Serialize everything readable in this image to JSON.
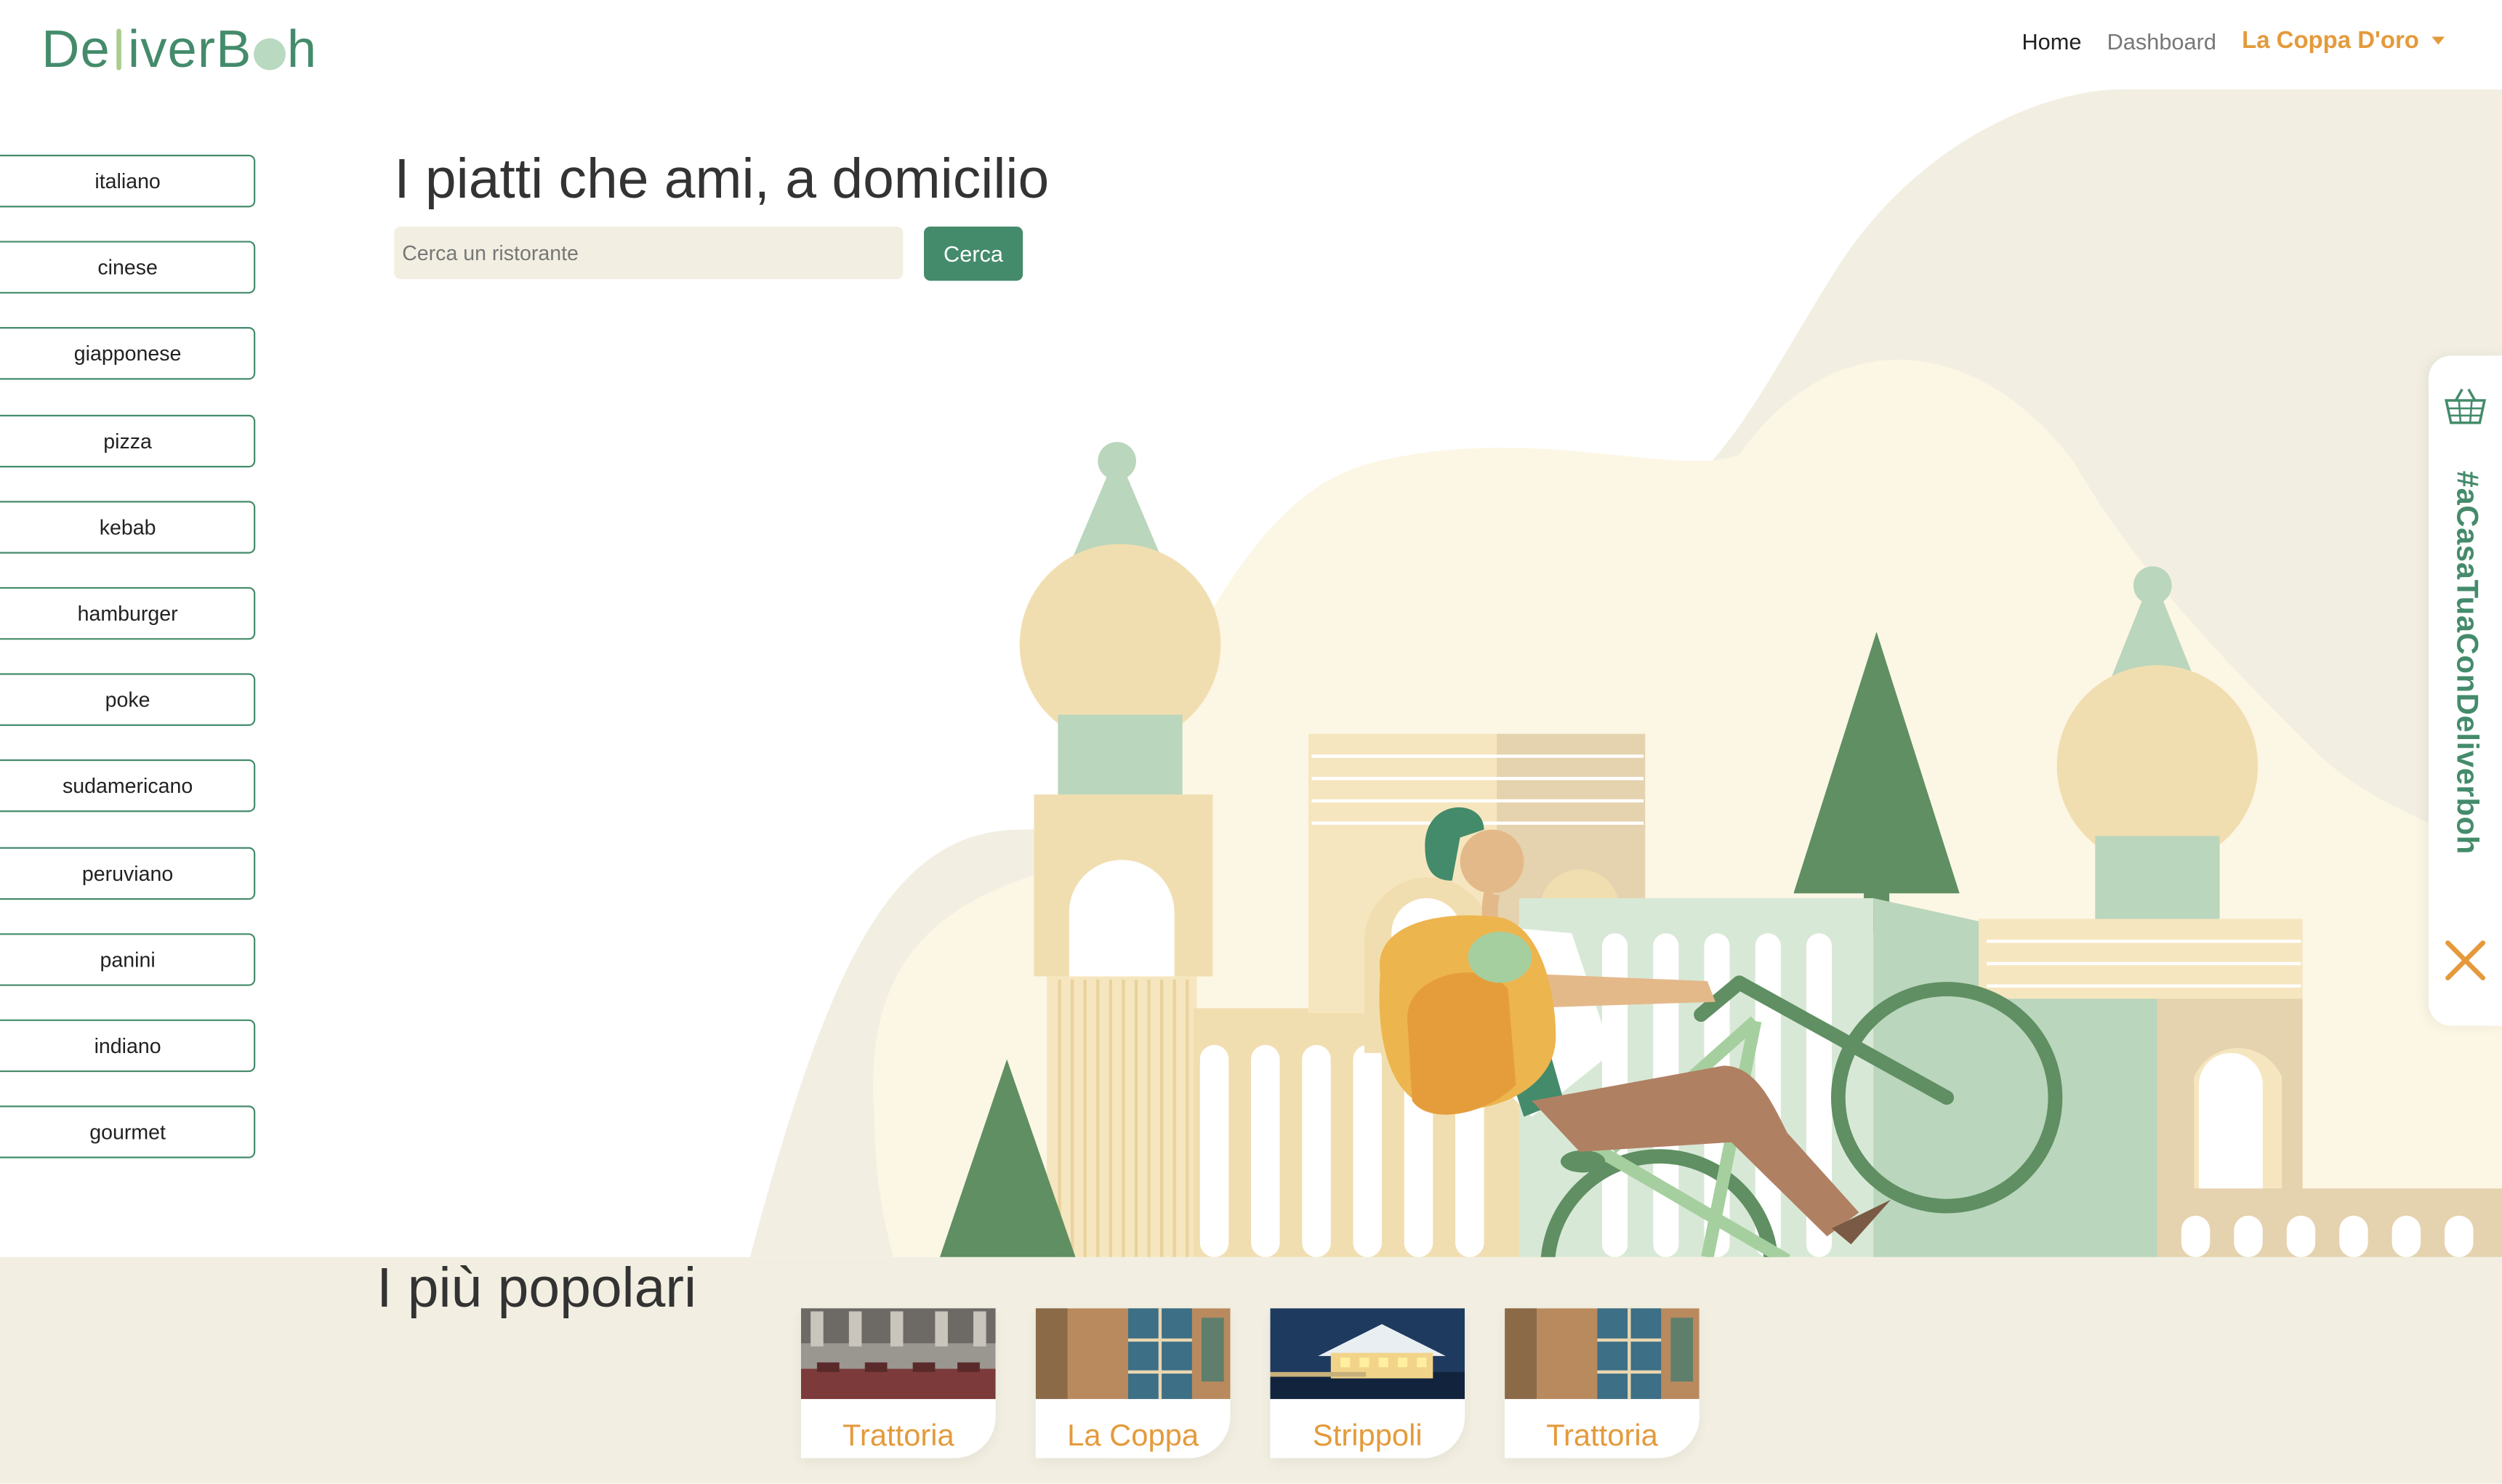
{
  "header": {
    "logo_text_a": "De",
    "logo_text_b": "iverB",
    "logo_text_c": "h",
    "nav_home": "Home",
    "nav_dashboard": "Dashboard",
    "nav_restaurant": "La Coppa D'oro"
  },
  "categories": [
    "italiano",
    "cinese",
    "giapponese",
    "pizza",
    "kebab",
    "hamburger",
    "poke",
    "sudamericano",
    "peruviano",
    "panini",
    "indiano",
    "gourmet"
  ],
  "hero": {
    "title": "I piatti che ami, a domicilio",
    "search_placeholder": "Cerca un ristorante",
    "search_value": "",
    "search_button": "Cerca"
  },
  "side_tab": {
    "hashtag": "#aCasaTuaConDeliverboh",
    "basket_icon": "basket-icon",
    "close_icon": "close-icon"
  },
  "popular": {
    "title": "I più popolari",
    "restaurants": [
      "Trattoria",
      "La Coppa",
      "Strippoli",
      "Trattoria"
    ]
  },
  "colors": {
    "brand_green": "#448b6b",
    "accent_orange": "#e49a3b",
    "cream": "#f2efe2"
  }
}
